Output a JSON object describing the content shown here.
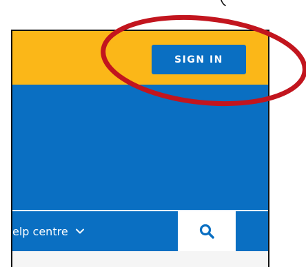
{
  "header": {
    "signin_label": "SIGN IN",
    "background": "#fbb718"
  },
  "hero": {
    "background": "#0a6fc2"
  },
  "nav": {
    "help_label": "elp centre",
    "chevron_icon": "chevron-down-icon",
    "search_icon": "search-icon",
    "search_icon_color": "#0a6fc2"
  },
  "annotation": {
    "shape": "ellipse",
    "color": "#c2151e"
  }
}
